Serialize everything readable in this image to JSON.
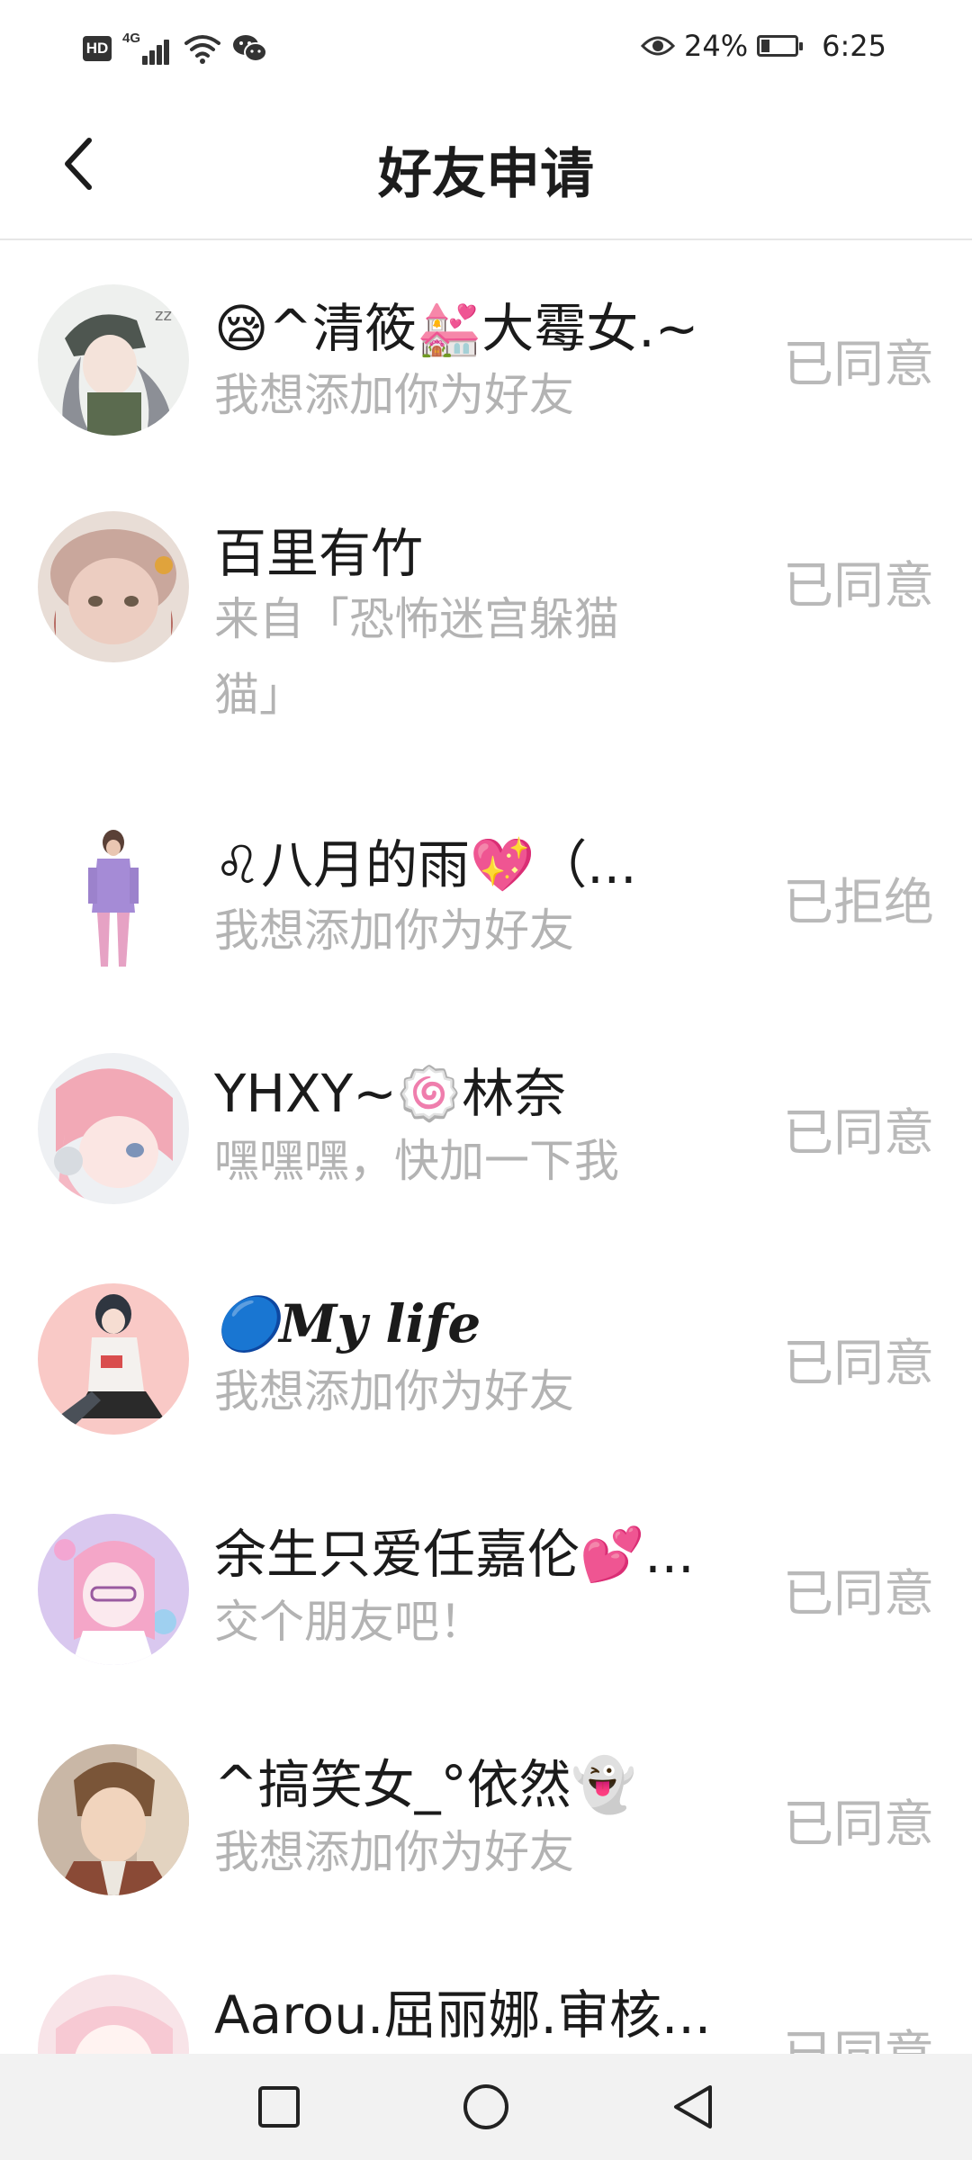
{
  "status_bar": {
    "hd": "HD",
    "network": "4G",
    "battery_percent": "24%",
    "battery_level": 0.24,
    "time": "6:25",
    "icons": [
      "hd-icon",
      "signal-icon",
      "wifi-icon",
      "wechat-icon",
      "eye-icon",
      "battery-icon"
    ]
  },
  "header": {
    "title": "好友申请",
    "back_icon": "chevron-left-icon"
  },
  "requests": [
    {
      "name": "😪^清筱💒大霉女.~",
      "message": "我想添加你为好友",
      "status": "已同意"
    },
    {
      "name": "百里有竹",
      "message": "来自「恐怖迷宫躲猫猫」",
      "status": "已同意"
    },
    {
      "name": "♌八月的雨💖（...",
      "message": "我想添加你为好友",
      "status": "已拒绝"
    },
    {
      "name": "YHXY~🍥林奈",
      "message": "嘿嘿嘿，快加一下我",
      "status": "已同意"
    },
    {
      "name": "🔵My life",
      "message": "我想添加你为好友",
      "status": "已同意"
    },
    {
      "name": "余生只爱任嘉伦💕...",
      "message": "交个朋友吧！",
      "status": "已同意"
    },
    {
      "name": "^搞笑女_°依然👻",
      "message": "我想添加你为好友",
      "status": "已同意"
    },
    {
      "name": "Aarou.屈丽娜.审核...",
      "message": "",
      "status": "已同意"
    }
  ],
  "nav": {
    "icons": [
      "recent-apps-icon",
      "home-icon",
      "back-icon"
    ]
  },
  "colors": {
    "name_text": "#1b1b1b",
    "secondary_text": "#b3b3b3",
    "status_text": "#b9b9b9",
    "divider": "#e6e6e6",
    "navbar_bg": "#f2f2f2"
  }
}
